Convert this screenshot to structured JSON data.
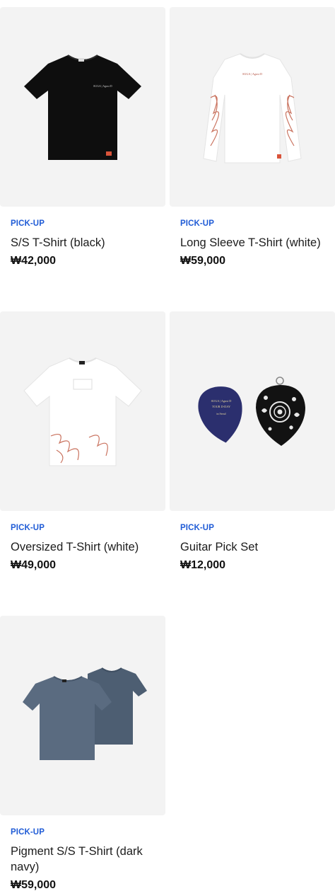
{
  "products": [
    {
      "tag": "PICK-UP",
      "name": "S/S T-Shirt (black)",
      "price": "₩42,000",
      "image": "black-tshirt",
      "print": "SUGA | Agust D"
    },
    {
      "tag": "PICK-UP",
      "name": "Long Sleeve T-Shirt (white)",
      "price": "₩59,000",
      "image": "white-longsleeve",
      "print": "SUGA | Agust D"
    },
    {
      "tag": "PICK-UP",
      "name": "Oversized T-Shirt (white)",
      "price": "₩49,000",
      "image": "white-oversized-tshirt",
      "print": ""
    },
    {
      "tag": "PICK-UP",
      "name": "Guitar Pick Set",
      "price": "₩12,000",
      "image": "guitar-pick-set",
      "pick_text": [
        "SUGA | Agust D",
        "TOUR D-DAY",
        "in Seoul"
      ]
    },
    {
      "tag": "PICK-UP",
      "name": "Pigment S/S T-Shirt (dark navy)",
      "price": "₩59,000",
      "image": "navy-pigment-tshirt",
      "print": ""
    }
  ],
  "colors": {
    "tag": "#1f5bd6",
    "thumb_bg": "#f3f3f3",
    "black_shirt": "#0e0e0e",
    "navy_shirt": "#5a6b80",
    "pick_blue": "#2b2f6e",
    "accent_red": "#d9533a"
  }
}
